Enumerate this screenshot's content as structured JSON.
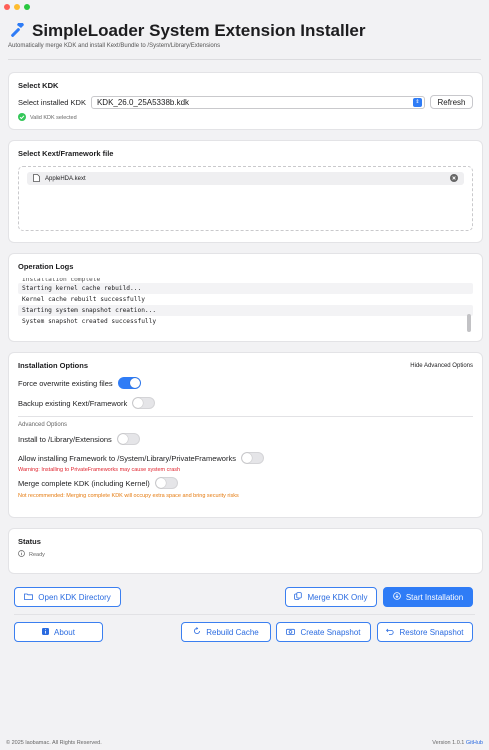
{
  "app": {
    "title": "SimpleLoader System Extension Installer",
    "subtitle": "Automatically merge KDK and install Kext/Bundle to /System/Library/Extensions",
    "accent": "#2f7cf6"
  },
  "kdk": {
    "section_title": "Select KDK",
    "select_label": "Select installed KDK",
    "selected_value": "KDK_26.0_25A5338b.kdk",
    "refresh_label": "Refresh",
    "status_text": "Valid KDK selected",
    "status_color": "#34c759"
  },
  "kext": {
    "section_title": "Select Kext/Framework file",
    "files": [
      "AppleHDA.kext"
    ]
  },
  "logs": {
    "section_title": "Operation Logs",
    "partial_line": "Installation complete",
    "lines": [
      "Starting kernel cache rebuild...",
      "Kernel cache rebuilt successfully",
      "Starting system snapshot creation...",
      "System snapshot created successfully"
    ]
  },
  "options": {
    "section_title": "Installation Options",
    "advanced_toggle_label": "Hide Advanced Options",
    "force_overwrite_label": "Force overwrite existing files",
    "force_overwrite_on": true,
    "backup_label": "Backup existing Kext/Framework",
    "backup_on": false,
    "advanced_heading": "Advanced Options",
    "install_library_label": "Install to /Library/Extensions",
    "install_library_on": false,
    "private_frameworks_label": "Allow installing Framework to /System/Library/PrivateFrameworks",
    "private_frameworks_on": false,
    "private_frameworks_warning": "Warning: Installing to PrivateFrameworks may cause system crash",
    "merge_kdk_label": "Merge complete KDK (including Kernel)",
    "merge_kdk_on": false,
    "merge_kdk_warning": "Not recommended: Merging complete KDK will occupy extra space and bring security risks"
  },
  "status": {
    "section_title": "Status",
    "text": "Ready"
  },
  "actions": {
    "open_kdk_dir": "Open KDK Directory",
    "merge_kdk_only": "Merge KDK Only",
    "start_installation": "Start Installation",
    "about": "About",
    "rebuild_cache": "Rebuild Cache",
    "create_snapshot": "Create Snapshot",
    "restore_snapshot": "Restore Snapshot"
  },
  "footer": {
    "copyright": "© 2025 laobamac. All Rights Reserved.",
    "version": "Version 1.0.1",
    "github": "GitHub"
  }
}
